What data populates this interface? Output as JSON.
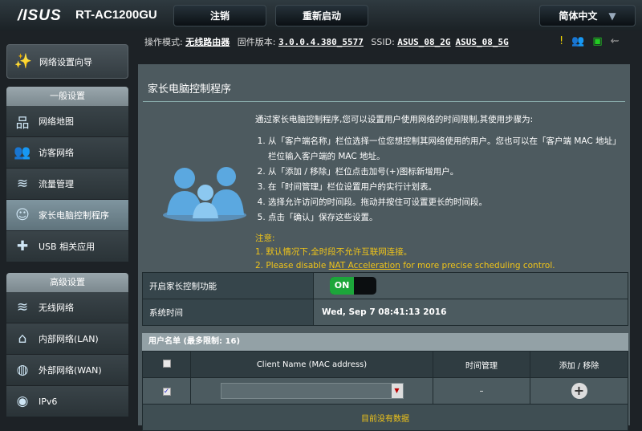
{
  "header": {
    "logo": "/ISUS",
    "model": "RT-AC1200GU",
    "logout": "注销",
    "reboot": "重新启动",
    "language": "简体中文"
  },
  "status": {
    "mode_label": "操作模式:",
    "mode": "无线路由器",
    "fw_label": "固件版本:",
    "fw": "3.0.0.4.380_5577",
    "ssid_label": "SSID:",
    "ssid_2g": "ASUS_08_2G",
    "ssid_5g": "ASUS_08_5G"
  },
  "sidebar": {
    "quick": "网络设置向导",
    "general": "一般设置",
    "general_items": [
      {
        "label": "网络地图",
        "icon": "network-map-icon"
      },
      {
        "label": "访客网络",
        "icon": "guest-network-icon"
      },
      {
        "label": "流量管理",
        "icon": "traffic-icon"
      },
      {
        "label": "家长电脑控制程序",
        "icon": "parental-icon"
      },
      {
        "label": "USB 相关应用",
        "icon": "usb-icon"
      }
    ],
    "advanced": "高级设置",
    "advanced_items": [
      {
        "label": "无线网络"
      },
      {
        "label": "内部网络(LAN)"
      },
      {
        "label": "外部网络(WAN)"
      },
      {
        "label": "IPv6"
      }
    ]
  },
  "main": {
    "title": "家长电脑控制程序",
    "intro": "通过家长电脑控制程序,您可以设置用户使用网络的时间限制,其使用步骤为:",
    "steps": [
      "从「客户端名称」栏位选择一位您想控制其网络使用的用户。您也可以在「客户端 MAC 地址」栏位输入客户端的 MAC 地址。",
      "从「添加 / 移除」栏位点击加号(+)图标新增用户。",
      "在「时间管理」栏位设置用户的实行计划表。",
      "选择允许访问的时间段。拖动并按住可设置更长的时间段。",
      "点击「确认」保存这些设置。"
    ],
    "note_title": "注意:",
    "note1": "1.  默认情况下,全时段不允许互联网连接。",
    "note2_pre": "2.  Please disable ",
    "note2_link": "NAT Acceleration",
    "note2_post": " for more precise scheduling control.",
    "enable_label": "开启家长控制功能",
    "toggle": "ON",
    "time_label": "系统时间",
    "time": "Wed, Sep 7  08:41:13 2016",
    "list_header": "用户名单 (最多限制:  16)",
    "cols": [
      "Client Name (MAC address)",
      "时间管理",
      "添加 / 移除"
    ],
    "dash": "–",
    "empty": "目前没有数据"
  }
}
